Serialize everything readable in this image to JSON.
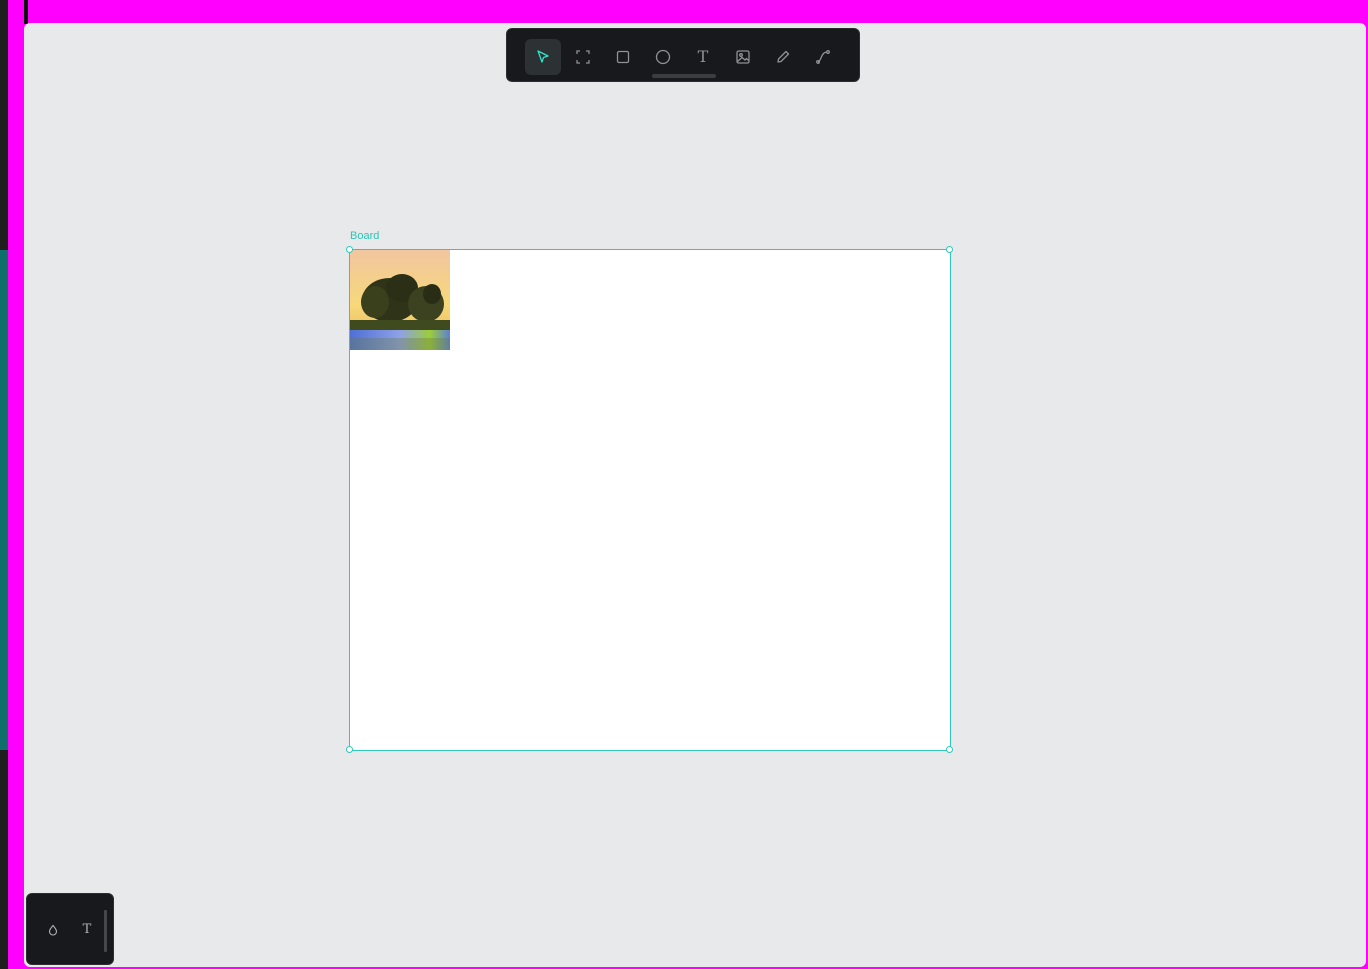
{
  "toolbar": {
    "tools": [
      {
        "name": "move-tool",
        "icon": "pointer-icon",
        "active": true
      },
      {
        "name": "board-tool",
        "icon": "frame-icon",
        "active": false
      },
      {
        "name": "rectangle-tool",
        "icon": "rectangle-icon",
        "active": false
      },
      {
        "name": "ellipse-tool",
        "icon": "ellipse-icon",
        "active": false
      },
      {
        "name": "text-tool",
        "icon": "text-icon",
        "label": "T",
        "active": false
      },
      {
        "name": "image-tool",
        "icon": "image-icon",
        "active": false
      },
      {
        "name": "pencil-tool",
        "icon": "pencil-icon",
        "active": false
      },
      {
        "name": "path-tool",
        "icon": "path-icon",
        "active": false
      }
    ]
  },
  "board": {
    "title": "Board",
    "selected": true
  },
  "palette": {
    "color_icon": "droplet-icon",
    "text_label": "T"
  },
  "colors": {
    "accent": "#31c8b9",
    "toolbar_bg": "#18191c",
    "canvas_bg": "#e8e9eb",
    "frame": "#ff00ff"
  }
}
